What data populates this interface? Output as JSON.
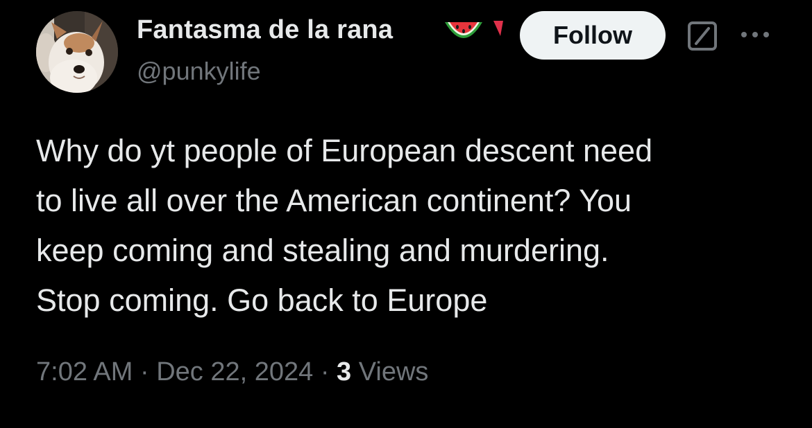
{
  "author": {
    "display_name": "Fantasma de la rana",
    "handle": "@punkylife",
    "avatar": "dog-photo-avatar",
    "name_emoji": "watermelon-icon",
    "badge": "red-triangle-flag-icon"
  },
  "actions": {
    "follow_label": "Follow",
    "grok_icon": "grok-icon",
    "more_icon": "more-icon"
  },
  "tweet": {
    "lines": [
      "Why do yt people of European descent need",
      "to live all over the American continent? You",
      "keep coming and stealing and murdering.",
      "Stop coming. Go back to Europe"
    ]
  },
  "meta": {
    "time": "7:02 AM",
    "separator": "·",
    "date": "Dec 22, 2024",
    "views_count": "3",
    "views_label": "Views"
  },
  "colors": {
    "background": "#000000",
    "text_primary": "#e7e9ea",
    "text_secondary": "#71767b",
    "follow_bg": "#eff3f4",
    "follow_text": "#0f1419"
  }
}
